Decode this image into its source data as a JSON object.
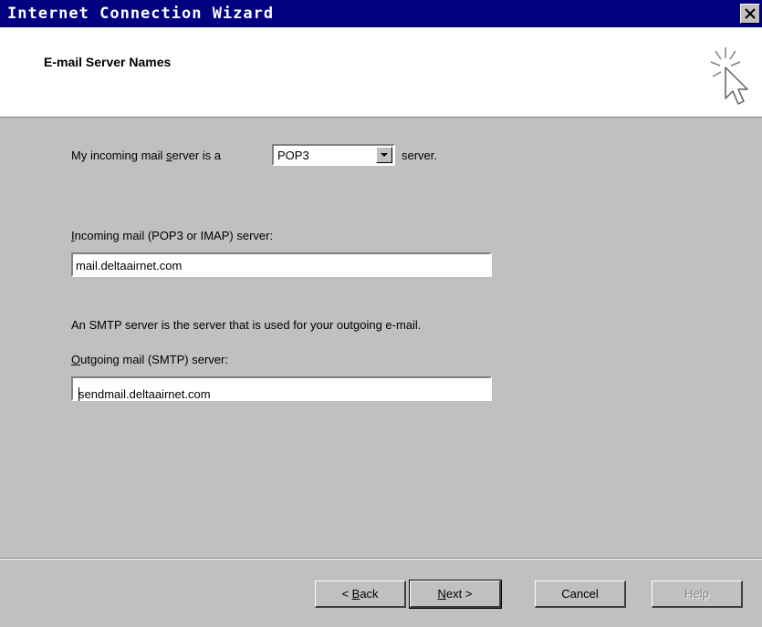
{
  "window": {
    "title": "Internet Connection Wizard",
    "close_glyph": "×"
  },
  "header": {
    "title": "E-mail Server Names",
    "icon": "wizard-cursor-icon"
  },
  "form": {
    "incoming_type_prefix": "My incoming mail ",
    "incoming_type_access": "s",
    "incoming_type_mid": "erver is a",
    "incoming_type_value": "POP3",
    "incoming_type_suffix": "server.",
    "incoming_label_access": "I",
    "incoming_label_rest": "ncoming mail (POP3 or IMAP) server:",
    "incoming_value": "mail.deltaairnet.com",
    "smtp_note": "An SMTP server is the server that is used for your outgoing e-mail.",
    "outgoing_label_access": "O",
    "outgoing_label_rest": "utgoing mail (SMTP) server:",
    "outgoing_value": "sendmail.deltaairnet.com"
  },
  "buttons": {
    "back_prefix": "< ",
    "back_access": "B",
    "back_rest": "ack",
    "next_access": "N",
    "next_rest": "ext >",
    "cancel": "Cancel",
    "help": "Help"
  },
  "colors": {
    "titlebar": "#000080",
    "face": "#c0c0c0",
    "header_bg": "#ffffff"
  }
}
